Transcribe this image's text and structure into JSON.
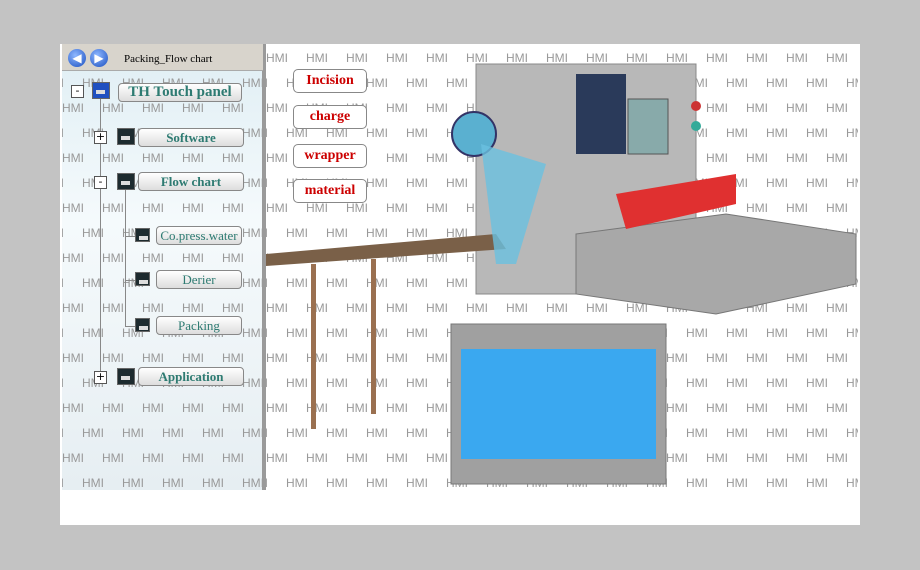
{
  "watermark": "HMI",
  "panel": {
    "title": "Packing_Flow chart",
    "back_icon": "arrow-left-icon",
    "forward_icon": "arrow-right-icon"
  },
  "tree": {
    "root": "TH Touch panel",
    "software": "Software",
    "flow_chart": "Flow chart",
    "children": [
      "Co.press.water",
      "Derier",
      "Packing"
    ],
    "application": "Application"
  },
  "labels": [
    "Incision",
    "charge",
    "wrapper",
    "material"
  ],
  "colors": {
    "label_text": "#cc0000",
    "node_text": "#2e7b72",
    "machine_window": "#3aa8f0",
    "hood_red": "#e03030"
  }
}
